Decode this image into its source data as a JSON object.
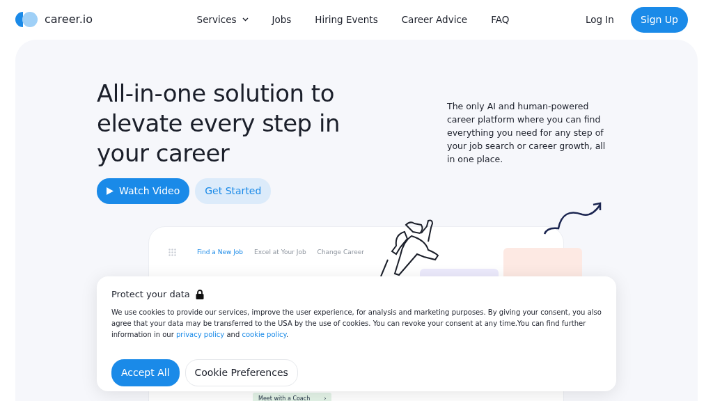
{
  "brand": {
    "name": "career.io"
  },
  "nav": [
    {
      "label": "Services",
      "dropdown": true
    },
    {
      "label": "Jobs",
      "dropdown": false
    },
    {
      "label": "Hiring Events",
      "dropdown": false
    },
    {
      "label": "Career Advice",
      "dropdown": false
    },
    {
      "label": "FAQ",
      "dropdown": false
    }
  ],
  "auth": {
    "login": "Log In",
    "signup": "Sign Up"
  },
  "hero": {
    "headline": "All-in-one solution to elevate every step in your career",
    "description": "The only AI and human-powered career platform where you can find everything you need for any step of your job search or career growth, all in one place.",
    "primary": "Watch Video",
    "secondary": "Get Started"
  },
  "preview": {
    "tabs": [
      {
        "label": "Find a New Job",
        "selected": true
      },
      {
        "label": "Excel at Your Job",
        "selected": false
      },
      {
        "label": "Change Career",
        "selected": false
      }
    ],
    "chip": "Meet with a Coach",
    "chip_arrow": "›"
  },
  "cookie": {
    "title": "Protect your data",
    "parts": [
      {
        "kind": "text",
        "text": "We use cookies to provide our services, improve the user experience, for analysis and marketing purposes. By giving your consent, you also agree that your data may be transferred to the USA by the use of cookies. You can revoke your consent at any time.You can find further information in our "
      },
      {
        "kind": "link",
        "text": "privacy policy"
      },
      {
        "kind": "text",
        "text": " and "
      },
      {
        "kind": "link",
        "text": "cookie policy"
      },
      {
        "kind": "text",
        "text": "."
      }
    ],
    "accept": "Accept All",
    "preferences": "Cookie Preferences"
  }
}
